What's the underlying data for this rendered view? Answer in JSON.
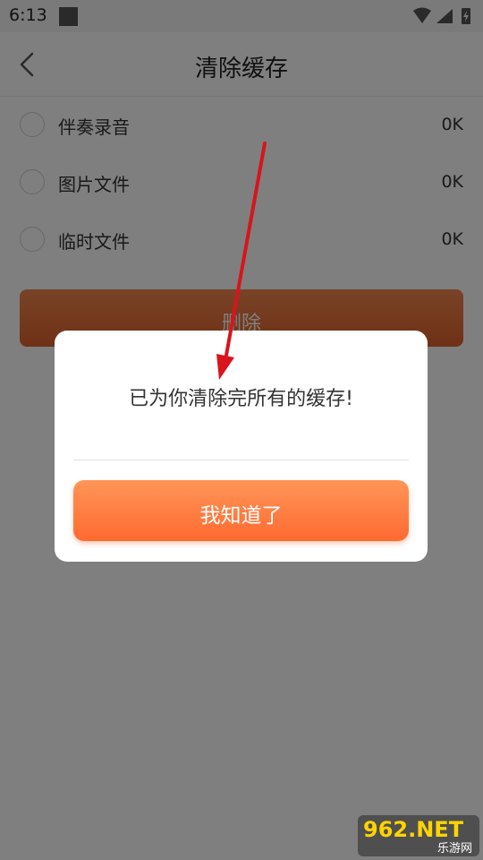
{
  "status_bar": {
    "time": "6:13"
  },
  "header": {
    "title": "清除缓存",
    "back_icon": "chevron-left-icon"
  },
  "cache_items": [
    {
      "label": "伴奏录音",
      "size": "0K"
    },
    {
      "label": "图片文件",
      "size": "0K"
    },
    {
      "label": "临时文件",
      "size": "0K"
    }
  ],
  "delete_button": {
    "label": "删除"
  },
  "dialog": {
    "message": "已为你清除完所有的缓存!",
    "confirm_label": "我知道了"
  },
  "watermark": {
    "logo": "962.NET",
    "sub": "乐游网"
  },
  "colors": {
    "accent": "#ff7a3d",
    "annotation_arrow": "#d8141c",
    "overlay": "#000000"
  }
}
